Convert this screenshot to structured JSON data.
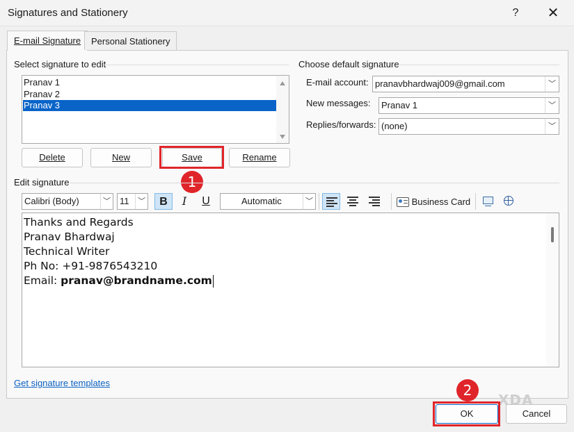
{
  "window": {
    "title": "Signatures and Stationery",
    "help": "?",
    "close": "✕"
  },
  "tabs": [
    {
      "label": "E-mail Signature",
      "active": true
    },
    {
      "label": "Personal Stationery",
      "active": false
    }
  ],
  "select_signature": {
    "label": "Select signature to edit",
    "items": [
      "Pranav 1",
      "Pranav 2",
      "Pranav 3"
    ],
    "selected_index": 2
  },
  "sig_buttons": {
    "delete": "Delete",
    "new": "New",
    "save": "Save",
    "rename": "Rename"
  },
  "default_signature": {
    "label": "Choose default signature",
    "email_account_label": "E-mail account:",
    "email_account_value": "pranavbhardwaj009@gmail.com",
    "new_messages_label": "New messages:",
    "new_messages_value": "Pranav 1",
    "replies_label": "Replies/forwards:",
    "replies_value": "(none)"
  },
  "edit_signature": {
    "label": "Edit signature",
    "font": "Calibri (Body)",
    "size": "11",
    "bold": "B",
    "italic": "I",
    "underline": "U",
    "color": "Automatic",
    "business_card": "Business Card",
    "lines": [
      "Thanks and Regards",
      "Pranav Bhardwaj",
      "Technical Writer",
      "Ph No: +91-9876543210"
    ],
    "email_prefix": "Email: ",
    "email_value": "pranav@brandname.com"
  },
  "templates_link": "Get signature templates",
  "footer": {
    "ok": "OK",
    "cancel": "Cancel"
  },
  "annotations": {
    "step1": "1",
    "step2": "2"
  },
  "watermark": "XDA",
  "colors": {
    "highlight": "#0a64c8",
    "annotation": "#e0252a",
    "link": "#0b61c3"
  }
}
